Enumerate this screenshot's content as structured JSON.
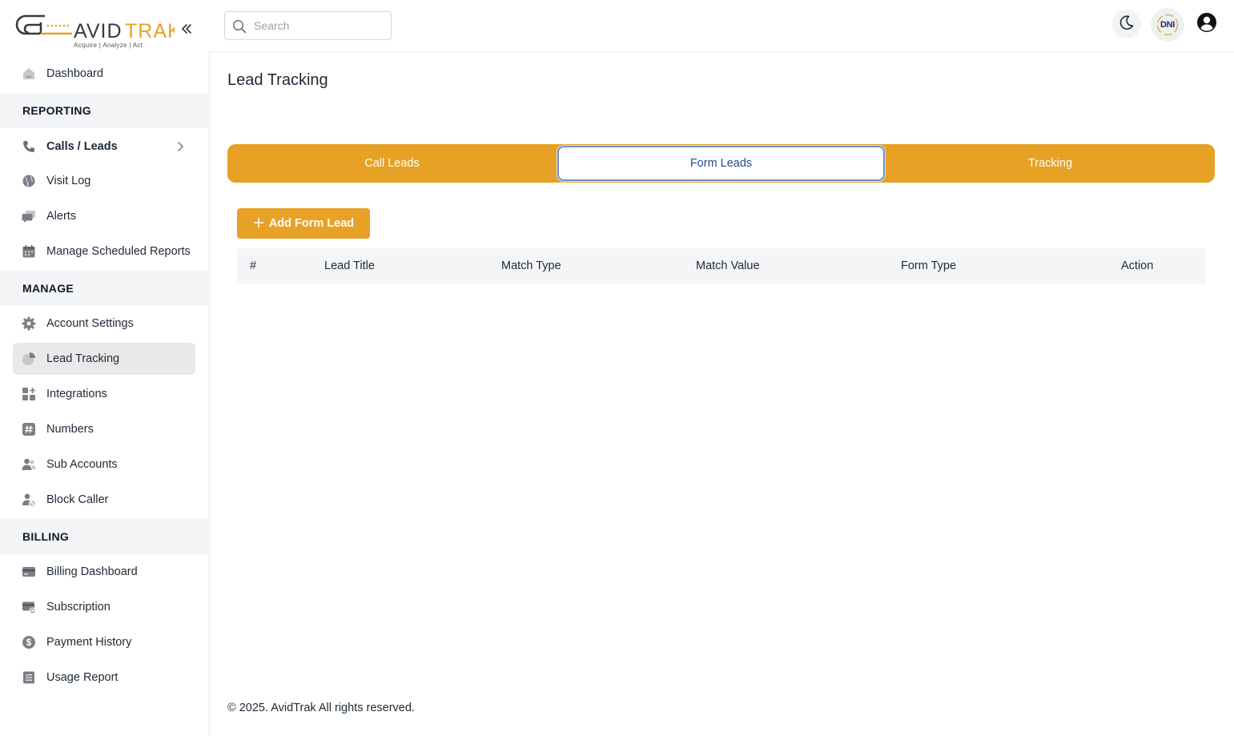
{
  "logo": {
    "name": "AVIDTRAK",
    "tagline": "Acquire | Analyze | Act"
  },
  "sidebar": {
    "items": [
      {
        "label": "Dashboard",
        "icon": "home-icon"
      },
      {
        "label": "Calls / Leads",
        "icon": "phone-icon"
      },
      {
        "label": "Visit Log",
        "icon": "globe-icon"
      },
      {
        "label": "Alerts",
        "icon": "chat-icon"
      },
      {
        "label": "Manage Scheduled Reports",
        "icon": "calendar-icon"
      },
      {
        "label": "Account Settings",
        "icon": "gear-icon"
      },
      {
        "label": "Lead Tracking",
        "icon": "pie-chart-icon",
        "active": true
      },
      {
        "label": "Integrations",
        "icon": "apps-plus-icon"
      },
      {
        "label": "Numbers",
        "icon": "hash-icon"
      },
      {
        "label": "Sub Accounts",
        "icon": "users-icon"
      },
      {
        "label": "Block Caller",
        "icon": "user-block-icon"
      },
      {
        "label": "Billing Dashboard",
        "icon": "credit-card-icon"
      },
      {
        "label": "Subscription",
        "icon": "card-refresh-icon"
      },
      {
        "label": "Payment History",
        "icon": "dollar-circle-icon"
      },
      {
        "label": "Usage Report",
        "icon": "report-icon"
      }
    ],
    "sections": {
      "reporting": "REPORTING",
      "manage": "MANAGE",
      "billing": "BILLING"
    }
  },
  "header": {
    "search_placeholder": "Search",
    "dni_label": "DNI"
  },
  "main": {
    "title": "Lead Tracking",
    "tabs": [
      {
        "label": "Call Leads"
      },
      {
        "label": "Form Leads",
        "selected": true
      },
      {
        "label": "Tracking"
      }
    ],
    "add_button": "Add Form Lead",
    "table_columns": [
      "#",
      "Lead Title",
      "Match Type",
      "Match Value",
      "Form Type",
      "Action"
    ]
  },
  "footer": {
    "text": "© 2025. AvidTrak All rights reserved."
  },
  "colors": {
    "accent": "#e7a124",
    "selected_tab_text": "#2b4a8b",
    "section_bg": "#f4f5f7",
    "active_item_bg": "#e9e9ea"
  }
}
